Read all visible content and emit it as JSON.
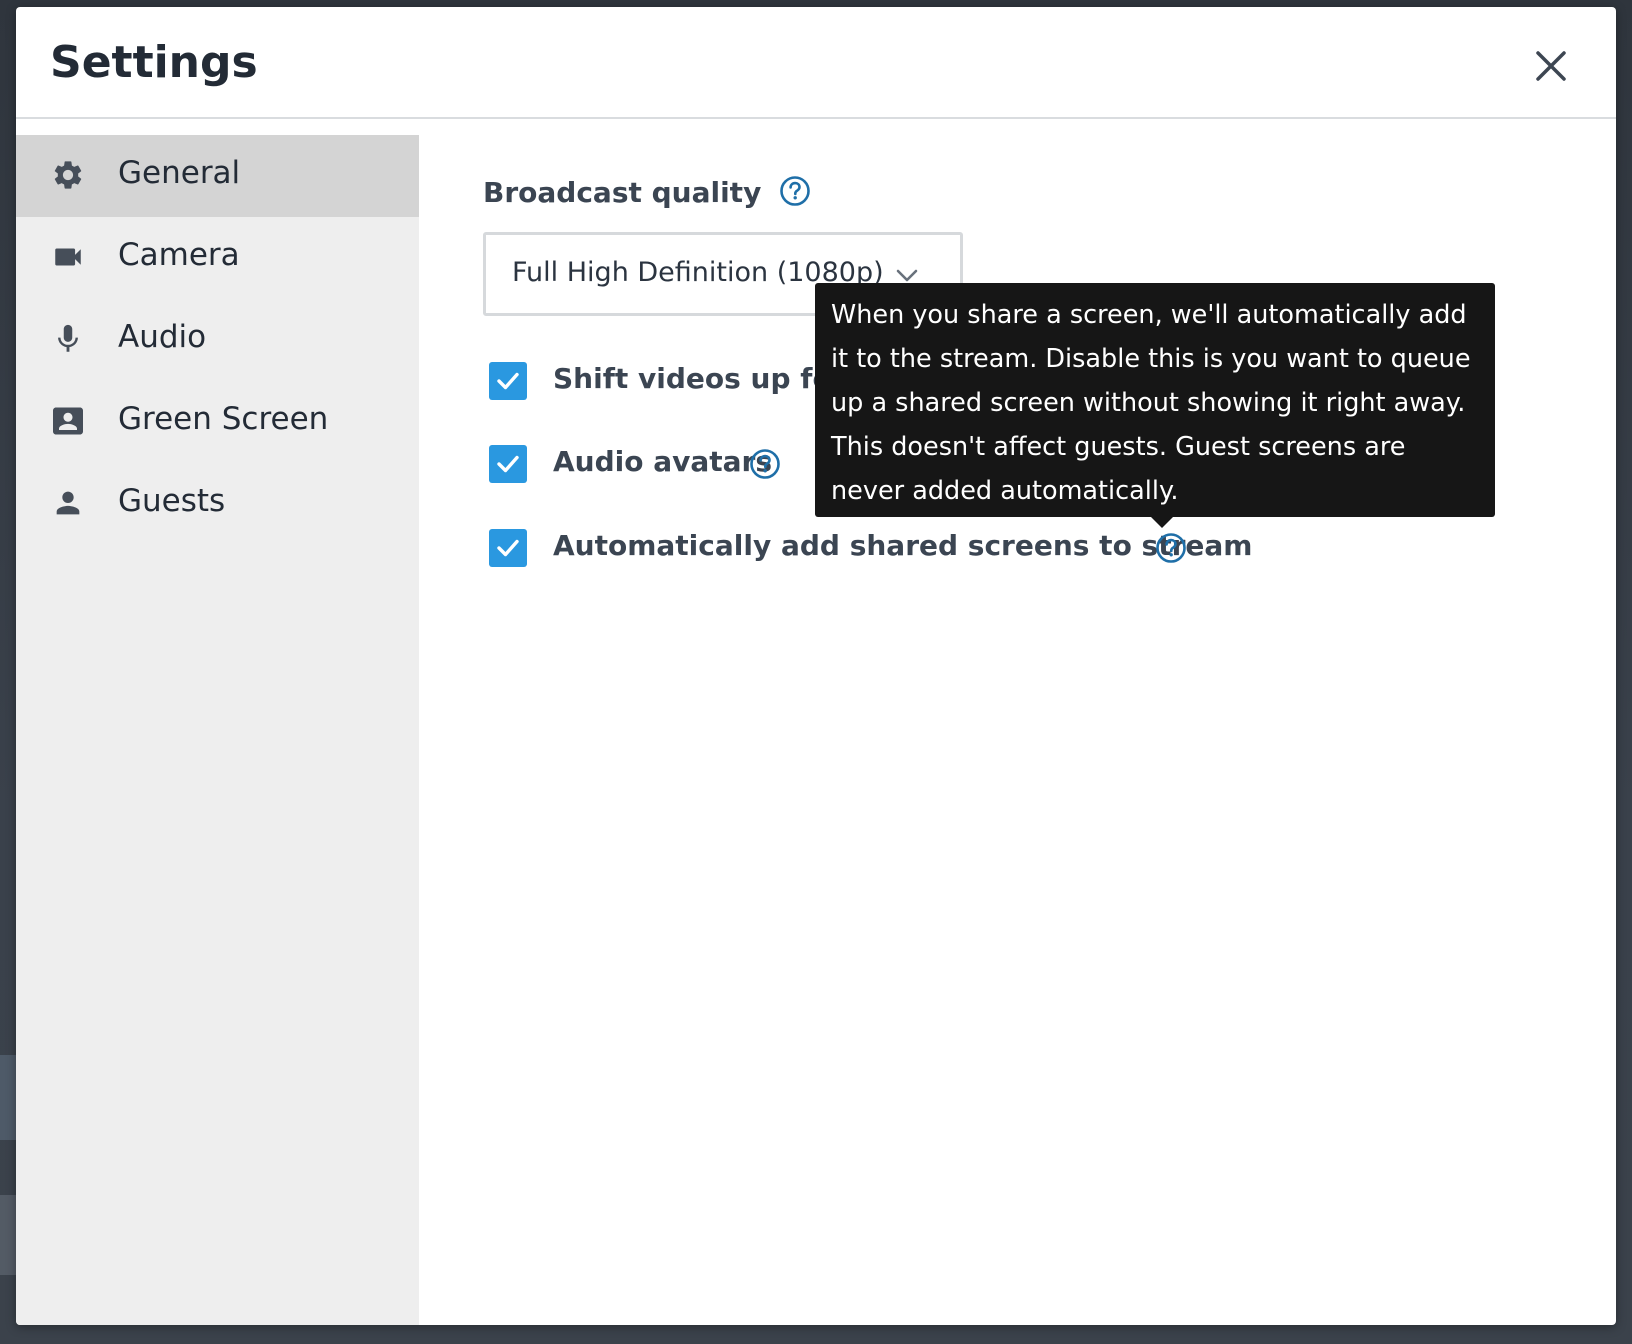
{
  "dialog": {
    "title": "Settings"
  },
  "sidebar": {
    "items": [
      {
        "label": "General",
        "icon": "gear-icon",
        "active": true
      },
      {
        "label": "Camera",
        "icon": "video-camera-icon",
        "active": false
      },
      {
        "label": "Audio",
        "icon": "microphone-icon",
        "active": false
      },
      {
        "label": "Green Screen",
        "icon": "contact-card-icon",
        "active": false
      },
      {
        "label": "Guests",
        "icon": "person-icon",
        "active": false
      }
    ]
  },
  "general": {
    "broadcast_quality_label": "Broadcast quality",
    "broadcast_quality_value": "Full High Definition (1080p)",
    "checkboxes": [
      {
        "label": "Shift videos up for co",
        "checked": true,
        "has_help": false
      },
      {
        "label": "Audio avatars",
        "checked": true,
        "has_help": true
      },
      {
        "label": "Automatically add shared screens to stream",
        "checked": true,
        "has_help": true
      }
    ]
  },
  "tooltip": {
    "text": "When you share a screen, we'll automatically add it to the stream. Disable this is you want to queue up a shared screen without showing it right away. This doesn't affect guests. Guest screens are never added automatically."
  },
  "colors": {
    "accent_blue": "#2a98e0",
    "help_icon_blue": "#1f6fa8",
    "sidebar_bg": "#eeeeee",
    "sidebar_active_bg": "#d4d4d4",
    "tooltip_bg": "#161616"
  }
}
